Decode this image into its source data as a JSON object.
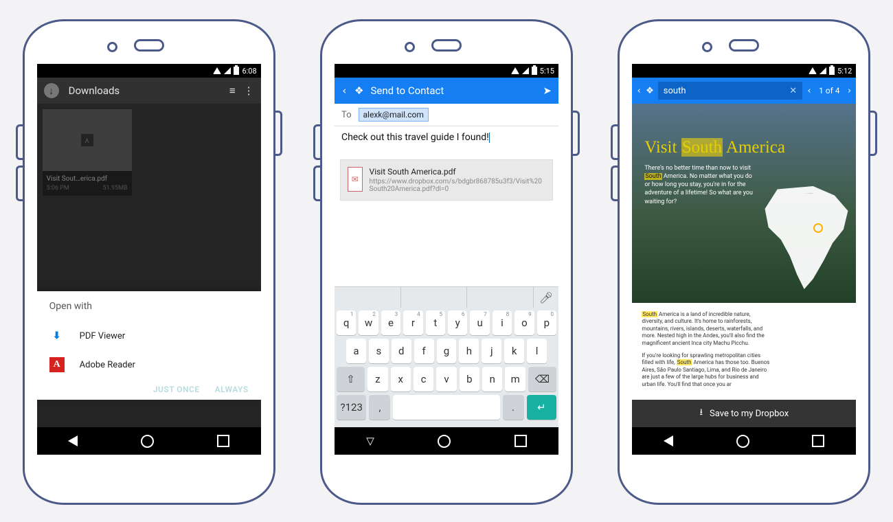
{
  "phone1": {
    "status_time": "6:08",
    "toolbar_title": "Downloads",
    "tile": {
      "filename": "Visit Sout…erica.pdf",
      "time": "5:06 PM",
      "size": "51.95MB"
    },
    "sheet_title": "Open with",
    "option1": "PDF Viewer",
    "option2": "Adobe Reader",
    "action_once": "JUST ONCE",
    "action_always": "ALWAYS"
  },
  "phone2": {
    "status_time": "5:15",
    "bar_title": "Send to Contact",
    "to_label": "To",
    "to_value": "alexk@mail.com",
    "message": "Check out this travel guide I found!",
    "attach_name": "Visit South America.pdf",
    "attach_link": "https://www.dropbox.com/s/bdgbr868785u3f3/Visit%20South20America.pdf?dl=0",
    "kb_row1": [
      "q",
      "w",
      "e",
      "r",
      "t",
      "y",
      "u",
      "i",
      "o",
      "p"
    ],
    "kb_row1_hints": [
      "1",
      "2",
      "3",
      "4",
      "5",
      "6",
      "7",
      "8",
      "9",
      "0"
    ],
    "kb_row2": [
      "a",
      "s",
      "d",
      "f",
      "g",
      "h",
      "j",
      "k",
      "l"
    ],
    "kb_row3": [
      "z",
      "x",
      "c",
      "v",
      "b",
      "n",
      "m"
    ],
    "kb_sym": "?123"
  },
  "phone3": {
    "status_time": "5:12",
    "search_value": "south",
    "result_pos": "1 of 4",
    "doc_title_pre": "Visit ",
    "doc_title_hl": "South",
    "doc_title_post": " America",
    "lead_1": "There's no better time than now to visit ",
    "lead_hl": "South",
    "lead_2": " America. No matter what you do or how long you stay, you're in for the adventure of a lifetime! So what are you waiting for?",
    "para1_hl": "South",
    "para1": " America is a land of incredible nature, diversity, and culture. It's home to rainforests, mountains, rivers, islands, deserts, waterfalls, and more. Nested high in the Andes, you'll also find the magnificent ancient Inca city Machu Picchu.",
    "para2a": "If you're looking for sprawling metropolitan cities filled with life, ",
    "para2_hl": "South",
    "para2b": " America has those too. Buenos Aires, São Paulo Santiago, Lima, and Rio de Janeiro are just a few of the large hubs for business and urban life. You'll find that once you ar",
    "save_label": "Save to my Dropbox"
  }
}
